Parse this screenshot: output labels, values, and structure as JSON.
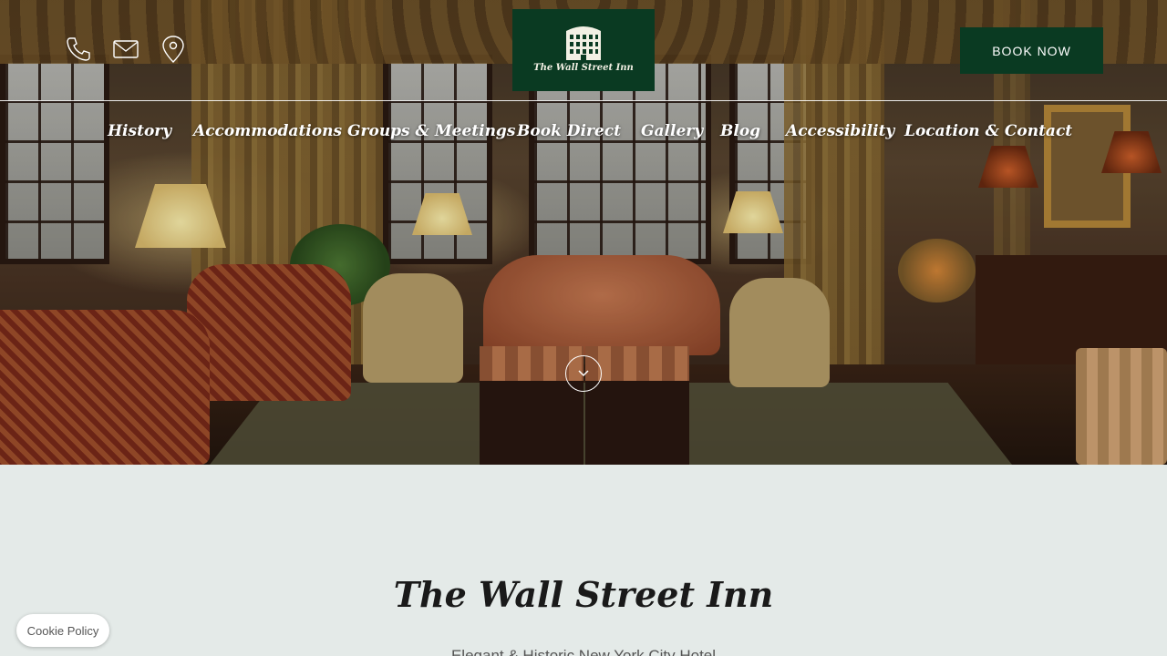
{
  "header": {
    "contact_icons": [
      "phone-icon",
      "mail-icon",
      "location-icon"
    ],
    "logo_text": "The Wall Street Inn",
    "book_button": "BOOK NOW",
    "accent_color": "#0a3a22"
  },
  "nav": {
    "items": [
      {
        "label": "History"
      },
      {
        "label": "Accommodations"
      },
      {
        "label": "Groups & Meetings"
      },
      {
        "label": "Book Direct"
      },
      {
        "label": "Gallery"
      },
      {
        "label": "Blog"
      },
      {
        "label": "Accessibility"
      },
      {
        "label": "Location & Contact"
      }
    ]
  },
  "hero": {
    "scroll_icon": "chevron-down-icon"
  },
  "main": {
    "title": "The Wall Street Inn",
    "subtitle": "Elegant & Historic New York City Hotel"
  },
  "cookie": {
    "label": "Cookie Policy"
  }
}
